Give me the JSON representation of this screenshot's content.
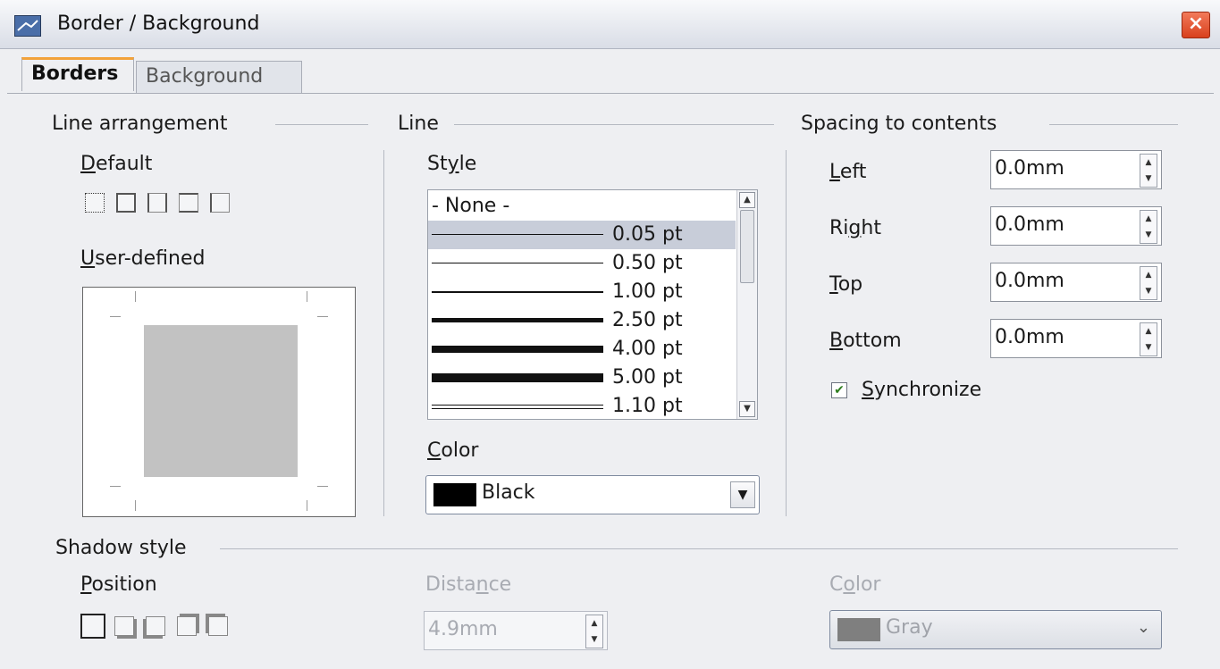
{
  "window": {
    "title": "Border / Background",
    "close_label": "×"
  },
  "tabs": [
    {
      "label": "Borders",
      "active": true
    },
    {
      "label": "Background",
      "active": false
    }
  ],
  "line_arrangement": {
    "heading": "Line arrangement",
    "default_label_mnemonic": "D",
    "default_label_rest": "efault",
    "user_defined_mnemonic": "U",
    "user_defined_rest": "ser-defined"
  },
  "line": {
    "heading": "Line",
    "style_pre": "St",
    "style_mnemonic": "y",
    "style_post": "le",
    "styles": [
      {
        "label": "- None -",
        "weight": 0,
        "selected": false
      },
      {
        "label": "0.05 pt",
        "weight": 1,
        "selected": true
      },
      {
        "label": "0.50 pt",
        "weight": 1,
        "selected": false
      },
      {
        "label": "1.00 pt",
        "weight": 2,
        "selected": false
      },
      {
        "label": "2.50 pt",
        "weight": 5,
        "selected": false
      },
      {
        "label": "4.00 pt",
        "weight": 8,
        "selected": false
      },
      {
        "label": "5.00 pt",
        "weight": 10,
        "selected": false
      },
      {
        "label": "1.10 pt",
        "weight": "double",
        "selected": false
      }
    ],
    "color_mnemonic": "C",
    "color_rest": "olor",
    "color_value": "Black",
    "color_hex": "#000000"
  },
  "spacing": {
    "heading": "Spacing to contents",
    "left_mnemonic": "L",
    "left_rest": "eft",
    "left_value": "0.0mm",
    "right_pre": "Ri",
    "right_mnemonic": "g",
    "right_post": "ht",
    "right_value": "0.0mm",
    "top_mnemonic": "T",
    "top_rest": "op",
    "top_value": "0.0mm",
    "bottom_mnemonic": "B",
    "bottom_rest": "ottom",
    "bottom_value": "0.0mm",
    "sync_mnemonic": "S",
    "sync_rest": "ynchronize",
    "sync_checked": "✔"
  },
  "shadow": {
    "heading": "Shadow style",
    "position_mnemonic": "P",
    "position_rest": "osition",
    "distance_pre": "Dista",
    "distance_mnemonic": "n",
    "distance_post": "ce",
    "distance_value": "4.9mm",
    "color_pre": "C",
    "color_mnemonic": "o",
    "color_post": "lor",
    "color_value": "Gray",
    "color_hex": "#7f7f7f"
  }
}
